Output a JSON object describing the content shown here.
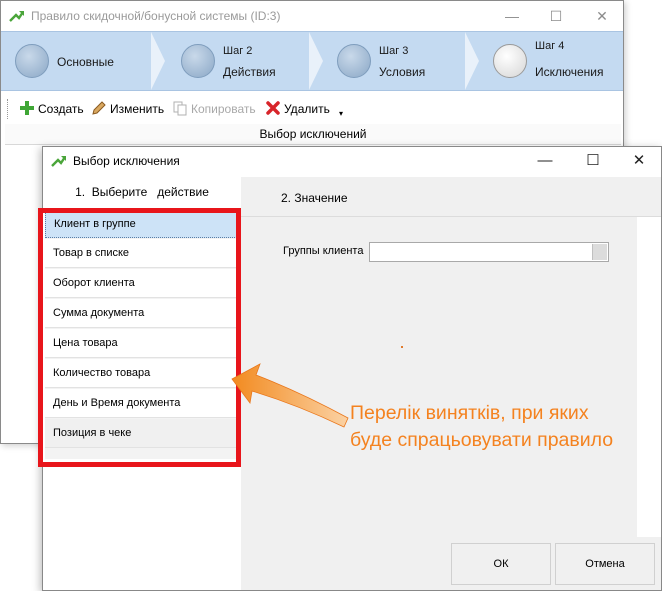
{
  "main_window": {
    "title": "Правило скидочной/бонусной системы (ID:3)",
    "controls": {
      "minimize": "—",
      "maximize": "☐",
      "close": "✕"
    },
    "steps": [
      {
        "small": "",
        "label": "Основные",
        "active": false
      },
      {
        "small": "Шаг 2",
        "label": "Действия",
        "active": false
      },
      {
        "small": "Шаг 3",
        "label": "Условия",
        "active": false
      },
      {
        "small": "Шаг 4",
        "label": "Исключения",
        "active": true
      }
    ],
    "toolbar": {
      "create": "Создать",
      "edit": "Изменить",
      "copy": "Копировать",
      "delete": "Удалить"
    },
    "grid_header": "Выбор  исключений"
  },
  "dialog": {
    "title": "Выбор исключения",
    "controls": {
      "minimize": "—",
      "maximize": "☐",
      "close": "✕"
    },
    "left_header": "1.  Выберите   действие",
    "actions": [
      "Клиент в группе",
      "Товар в списке",
      "Оборот клиента",
      "Сумма документа",
      "Цена товара",
      "Количество товара",
      "День и Время документа",
      "Позиция в чеке"
    ],
    "selected_index": 0,
    "right_header": "2. Значение",
    "field_label": "Группы клиента",
    "field_value": "",
    "ok": "ОК",
    "cancel": "Отмена"
  },
  "annotation": {
    "text_line1": "Перелік винятків, при яких",
    "text_line2": "буде спрацьовувати правило",
    "color": "#f4821f",
    "frame_color": "#e8151b"
  },
  "colors": {
    "steps_bg": "#c4daf1",
    "selected_item": "#cde3f7"
  }
}
